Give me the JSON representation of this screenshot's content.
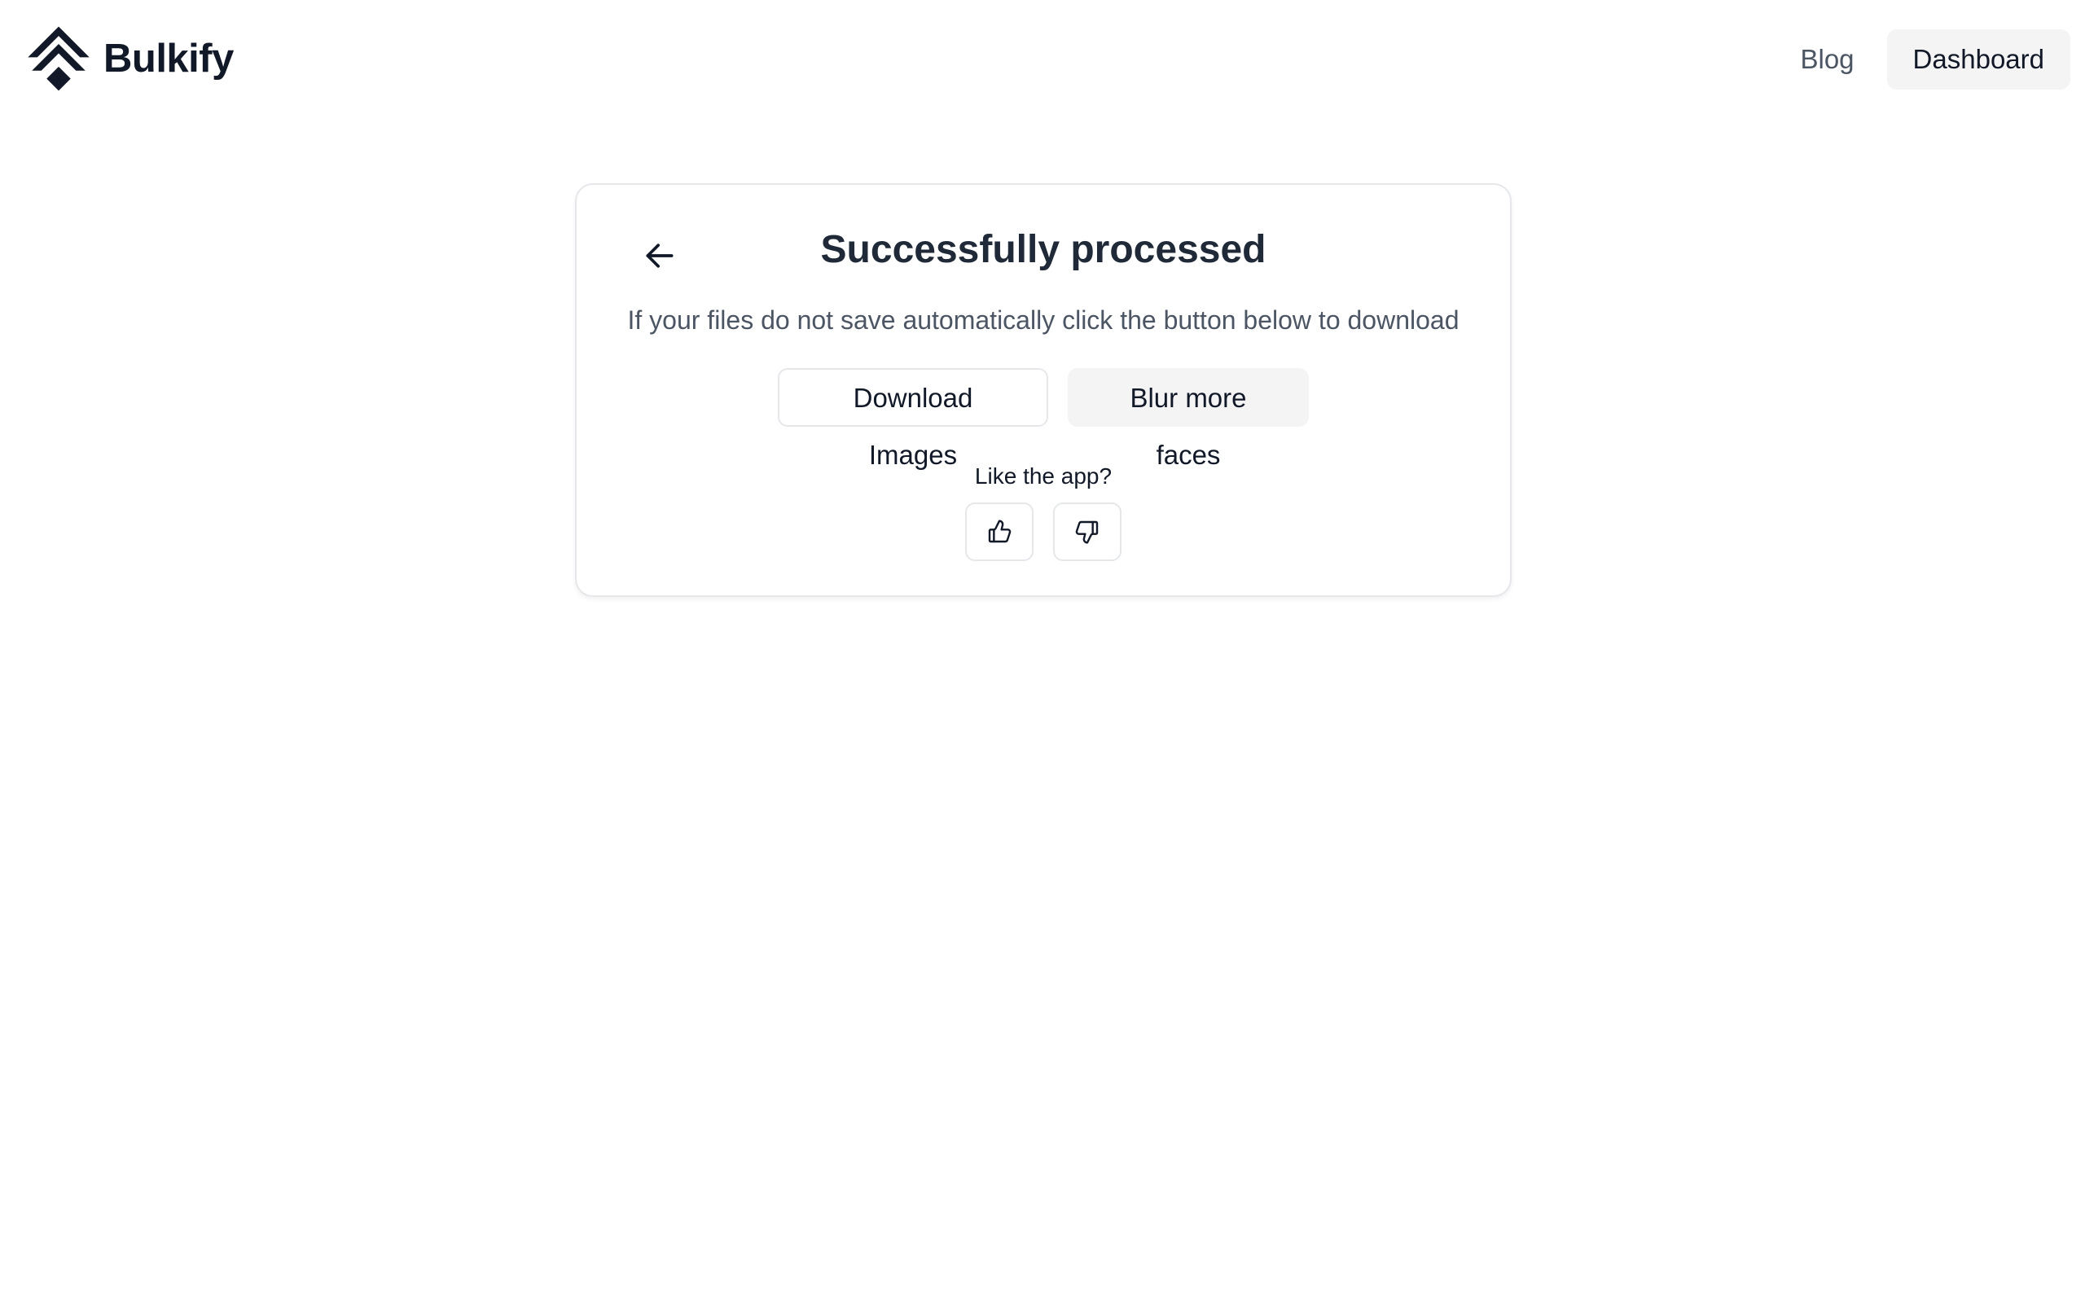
{
  "header": {
    "brand_name": "Bulkify",
    "logo_icon": "layered-diamond-logo",
    "nav": {
      "blog_label": "Blog",
      "dashboard_label": "Dashboard"
    }
  },
  "card": {
    "back_icon": "arrow-left-icon",
    "title": "Successfully processed",
    "subtitle": "If your files do not save automatically click the button below to download",
    "download_label": "Download Images",
    "blur_more_label": "Blur more faces",
    "feedback_label": "Like the app?",
    "thumbs_up_icon": "thumbs-up-icon",
    "thumbs_down_icon": "thumbs-down-icon"
  },
  "colors": {
    "text_primary": "#111827",
    "text_muted": "#4b5563",
    "border": "#e5e7eb",
    "secondary_bg": "#f4f4f5"
  }
}
